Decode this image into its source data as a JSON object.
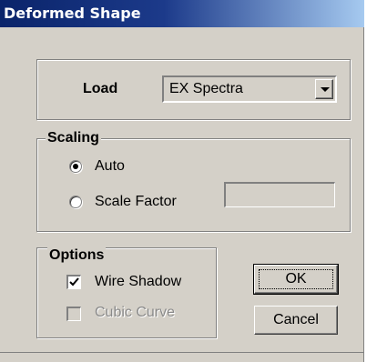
{
  "window": {
    "title": "Deformed Shape"
  },
  "load": {
    "label": "Load",
    "selected": "EX Spectra"
  },
  "scaling": {
    "legend": "Scaling",
    "options": [
      {
        "label": "Auto",
        "checked": true
      },
      {
        "label": "Scale Factor",
        "checked": false
      }
    ],
    "scale_factor_value": ""
  },
  "options": {
    "legend": "Options",
    "wire_shadow": {
      "label": "Wire Shadow",
      "checked": true,
      "enabled": true
    },
    "cubic_curve": {
      "label": "Cubic Curve",
      "checked": false,
      "enabled": false
    }
  },
  "buttons": {
    "ok": "OK",
    "cancel": "Cancel"
  },
  "icons": {
    "combo_arrow": "chevron-down-icon",
    "check": "checkmark-icon"
  },
  "colors": {
    "title_start": "#0a246a",
    "title_end": "#a6caf0",
    "dialog_bg": "#d4d0c8"
  }
}
